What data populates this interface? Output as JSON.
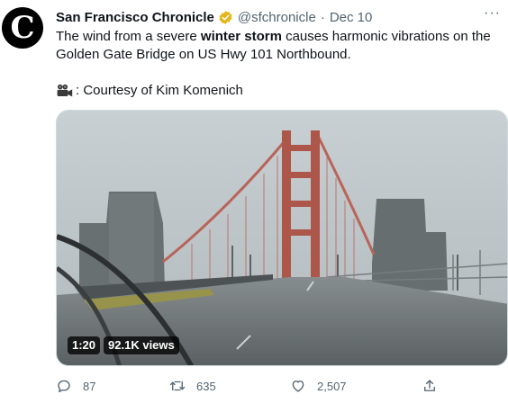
{
  "tweet": {
    "avatar_letter": "C",
    "author_name": "San Francisco Chronicle",
    "handle": "@sfchronicle",
    "separator": "·",
    "date": "Dec 10",
    "more_label": "···",
    "text_part1": "The wind from a severe ",
    "text_bold": "winter storm",
    "text_part2": " causes harmonic vibrations on the Golden Gate Bridge on US Hwy 101 Northbound.",
    "credit": ": Courtesy of Kim Komenich",
    "credit_icon": "video-camera-icon",
    "video": {
      "duration": "1:20",
      "views": "92.1K views"
    },
    "actions": {
      "replies": "87",
      "retweets": "635",
      "likes": "2,507"
    }
  },
  "colors": {
    "verified_badge": "#e2b719",
    "secondary_text": "#536471",
    "bridge_red": "#a5493b"
  }
}
